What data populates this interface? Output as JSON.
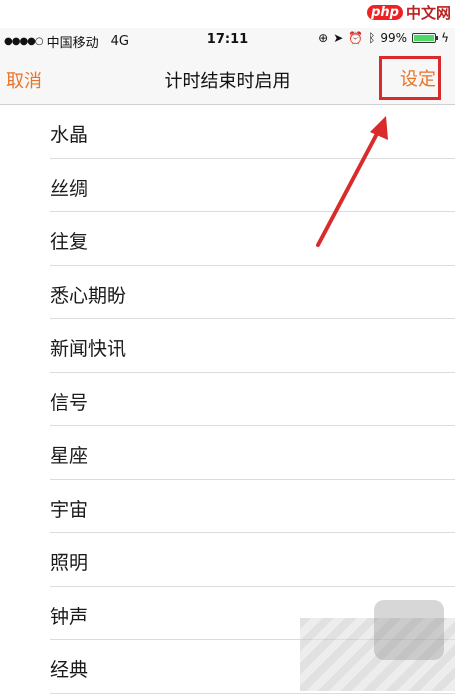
{
  "status": {
    "carrier": "中国移动",
    "network": "4G",
    "time": "17:11",
    "battery_text": "99%",
    "battery_level": 0.99
  },
  "watermark": {
    "badge": "php",
    "text": "中文网"
  },
  "nav": {
    "cancel_label": "取消",
    "title": "计时结束时启用",
    "set_label": "设定"
  },
  "items": [
    "水晶",
    "丝绸",
    "往复",
    "悉心期盼",
    "新闻快讯",
    "信号",
    "星座",
    "宇宙",
    "照明",
    "钟声",
    "经典"
  ],
  "colors": {
    "accent": "#e8732a",
    "annotation": "#d92b2b",
    "battery": "#4cd964"
  },
  "icons": [
    "signal-dots-icon",
    "rotation-lock-icon",
    "location-arrow-icon",
    "alarm-icon",
    "bluetooth-icon",
    "battery-icon",
    "charging-bolt-icon",
    "red-arrow-annotation"
  ]
}
